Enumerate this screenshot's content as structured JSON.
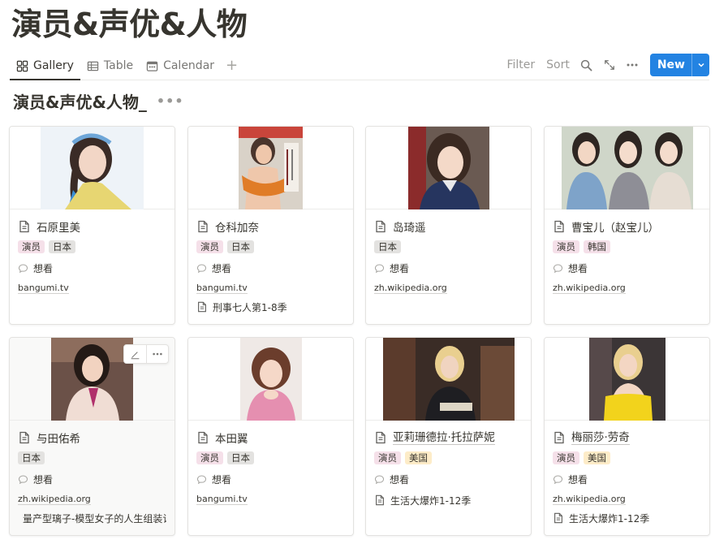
{
  "page": {
    "title": "演员&声优&人物"
  },
  "views": {
    "tabs": [
      {
        "label": "Gallery",
        "icon": "gallery-icon",
        "active": true
      },
      {
        "label": "Table",
        "icon": "table-icon",
        "active": false
      },
      {
        "label": "Calendar",
        "icon": "calendar-icon",
        "active": false
      }
    ],
    "add_view_icon": "plus-icon"
  },
  "toolbar": {
    "filter_label": "Filter",
    "sort_label": "Sort",
    "search_icon": "search-icon",
    "expand_icon": "expand-icon",
    "more_icon": "more-icon",
    "new_label": "New",
    "new_dropdown_icon": "chevron-down-icon"
  },
  "database": {
    "title": "演员&声优&人物_",
    "more_icon": "more-icon"
  },
  "colors": {
    "accent": "#2383e2",
    "tag_pink": "#f5e0e9",
    "tag_gray": "#e3e2e0",
    "tag_yellow": "#fdecc8",
    "text": "#37352f"
  },
  "cards": [
    {
      "name": "石原里美",
      "tags": [
        {
          "label": "演员",
          "color": "pink"
        },
        {
          "label": "日本",
          "color": "gray"
        }
      ],
      "status": "想看",
      "source": "bangumi.tv",
      "relation": ""
    },
    {
      "name": "仓科加奈",
      "tags": [
        {
          "label": "演员",
          "color": "pink"
        },
        {
          "label": "日本",
          "color": "gray"
        }
      ],
      "status": "想看",
      "source": "bangumi.tv",
      "relation": "刑事七人第1-8季"
    },
    {
      "name": "岛琦遥",
      "tags": [
        {
          "label": "日本",
          "color": "gray"
        }
      ],
      "status": "想看",
      "source": "zh.wikipedia.org",
      "relation": ""
    },
    {
      "name": "曹宝儿（赵宝儿）",
      "tags": [
        {
          "label": "演员",
          "color": "pink"
        },
        {
          "label": "韩国",
          "color": "pink"
        }
      ],
      "status": "想看",
      "source": "zh.wikipedia.org",
      "relation": ""
    },
    {
      "name": "与田佑希",
      "tags": [
        {
          "label": "日本",
          "color": "gray"
        }
      ],
      "status": "想看",
      "source": "zh.wikipedia.org",
      "relation": "量产型璃子-模型女子的人生组装计划"
    },
    {
      "name": "本田翼",
      "tags": [
        {
          "label": "演员",
          "color": "pink"
        },
        {
          "label": "日本",
          "color": "gray"
        }
      ],
      "status": "想看",
      "source": "bangumi.tv",
      "relation": ""
    },
    {
      "name": "亚莉珊德拉·托拉萨妮",
      "tags": [
        {
          "label": "演员",
          "color": "pink"
        },
        {
          "label": "美国",
          "color": "yellow"
        }
      ],
      "status": "想看",
      "source": "",
      "relation": "生活大爆炸1-12季"
    },
    {
      "name": "梅丽莎·劳奇",
      "tags": [
        {
          "label": "演员",
          "color": "pink"
        },
        {
          "label": "美国",
          "color": "yellow"
        }
      ],
      "status": "想看",
      "source": "zh.wikipedia.org",
      "relation": "生活大爆炸1-12季"
    }
  ]
}
